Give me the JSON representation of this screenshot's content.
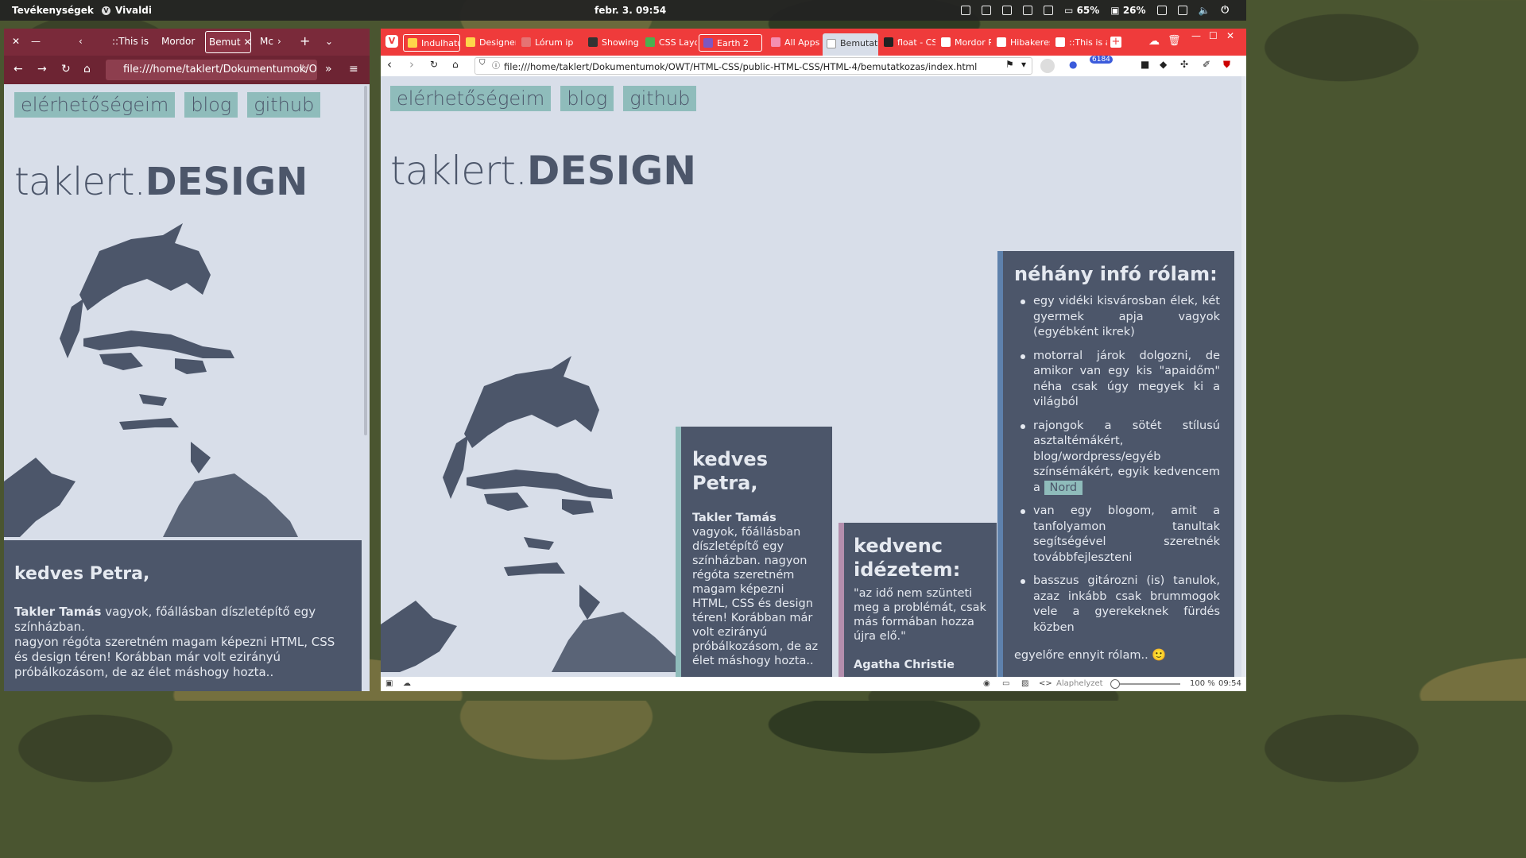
{
  "topbar": {
    "activities": "Tevékenységek",
    "app": "Vivaldi",
    "clock": "febr. 3.  09:54",
    "battery1": "65%",
    "battery2": "26%"
  },
  "left": {
    "tabs": [
      "::This is",
      "Mordor",
      "Bemut",
      "Mc"
    ],
    "url": "file:///home/taklert/Dokumentumok/O",
    "menu": [
      "elérhetőségeim",
      "blog",
      "github"
    ],
    "logo_a": "taklert.",
    "logo_b": "DESIGN",
    "card_title": "kedves Petra,",
    "card_name": "Takler Tamás",
    "card_line1": " vagyok, főállásban díszletépítő egy színházban.",
    "card_line2": "nagyon régóta szeretném magam képezni HTML, CSS és design téren! Korábban már volt ezirányú próbálkozásom, de az élet máshogy hozta.."
  },
  "right": {
    "tabs": [
      {
        "label": "Indulhatu",
        "color": "#ffd54a"
      },
      {
        "label": "Designer",
        "color": "#ffd54a"
      },
      {
        "label": "Lórum ip",
        "color": "#e57373"
      },
      {
        "label": "Showing r",
        "color": "#333"
      },
      {
        "label": "CSS Layo",
        "color": "#4caf50"
      },
      {
        "label": "Earth   2",
        "color": "#7e57c2"
      },
      {
        "label": "All Apps |",
        "color": "#f48fb1"
      },
      {
        "label": "Bemutatk",
        "color": "#ccc"
      },
      {
        "label": "float - CSS",
        "color": "#222"
      },
      {
        "label": "Mordor P",
        "color": "#fff"
      },
      {
        "label": "Hibakeres",
        "color": "#fff"
      },
      {
        "label": "::This is a",
        "color": "#fff"
      }
    ],
    "url": "file:///home/taklert/Dokumentumok/OWT/HTML-CSS/public-HTML-CSS/HTML-4/bemutatkozas/index.html",
    "badge": "6184",
    "menu": [
      "elérhetőségeim",
      "blog",
      "github"
    ],
    "logo_a": "taklert.",
    "logo_b": "DESIGN",
    "card1": {
      "title": "kedves Petra,",
      "name": "Takler Tamás",
      "text": " vagyok, főállásban díszletépítő egy színházban. nagyon régóta szeretném magam képezni HTML, CSS és design téren! Korábban már volt ezirányú próbálkozásom, de az élet máshogy hozta.."
    },
    "card2": {
      "title": "kedvenc idézetem:",
      "quote": "\"az idő nem szünteti meg a problémát, csak más formában hozza újra elő.\"",
      "author": "Agatha Christie"
    },
    "card3": {
      "title": "néhány infó rólam:",
      "items": [
        "egy vidéki kisvárosban élek, két gyermek apja vagyok (egyébként ikrek)",
        "motorral járok dolgozni, de amikor van egy kis \"apaidőm\" néha csak úgy megyek ki a világból",
        "rajongok a sötét stílusú asztaltémákért, blog/wordpress/egyéb színsémákért, egyik kedvencem a ",
        "van egy blogom, amit a tanfolyamon tanultak segítségével szeretnék továbbfejleszteni",
        "basszus gitározni (is) tanulok, azaz inkább csak brummogok vele a gyerekeknek fürdés közben"
      ],
      "nord": "Nord",
      "footer": "egyelőre ennyit rólam.. 🙂"
    },
    "status": {
      "reset": "Alaphelyzet",
      "zoom": "100 %",
      "time": "09:54"
    }
  },
  "colors": {
    "polar": "#4c566a",
    "snow": "#d8dee9",
    "frost": "#8fbcbb",
    "vivaldi_red": "#ef3b3b",
    "firefox_maroon": "#7a2a3a"
  }
}
